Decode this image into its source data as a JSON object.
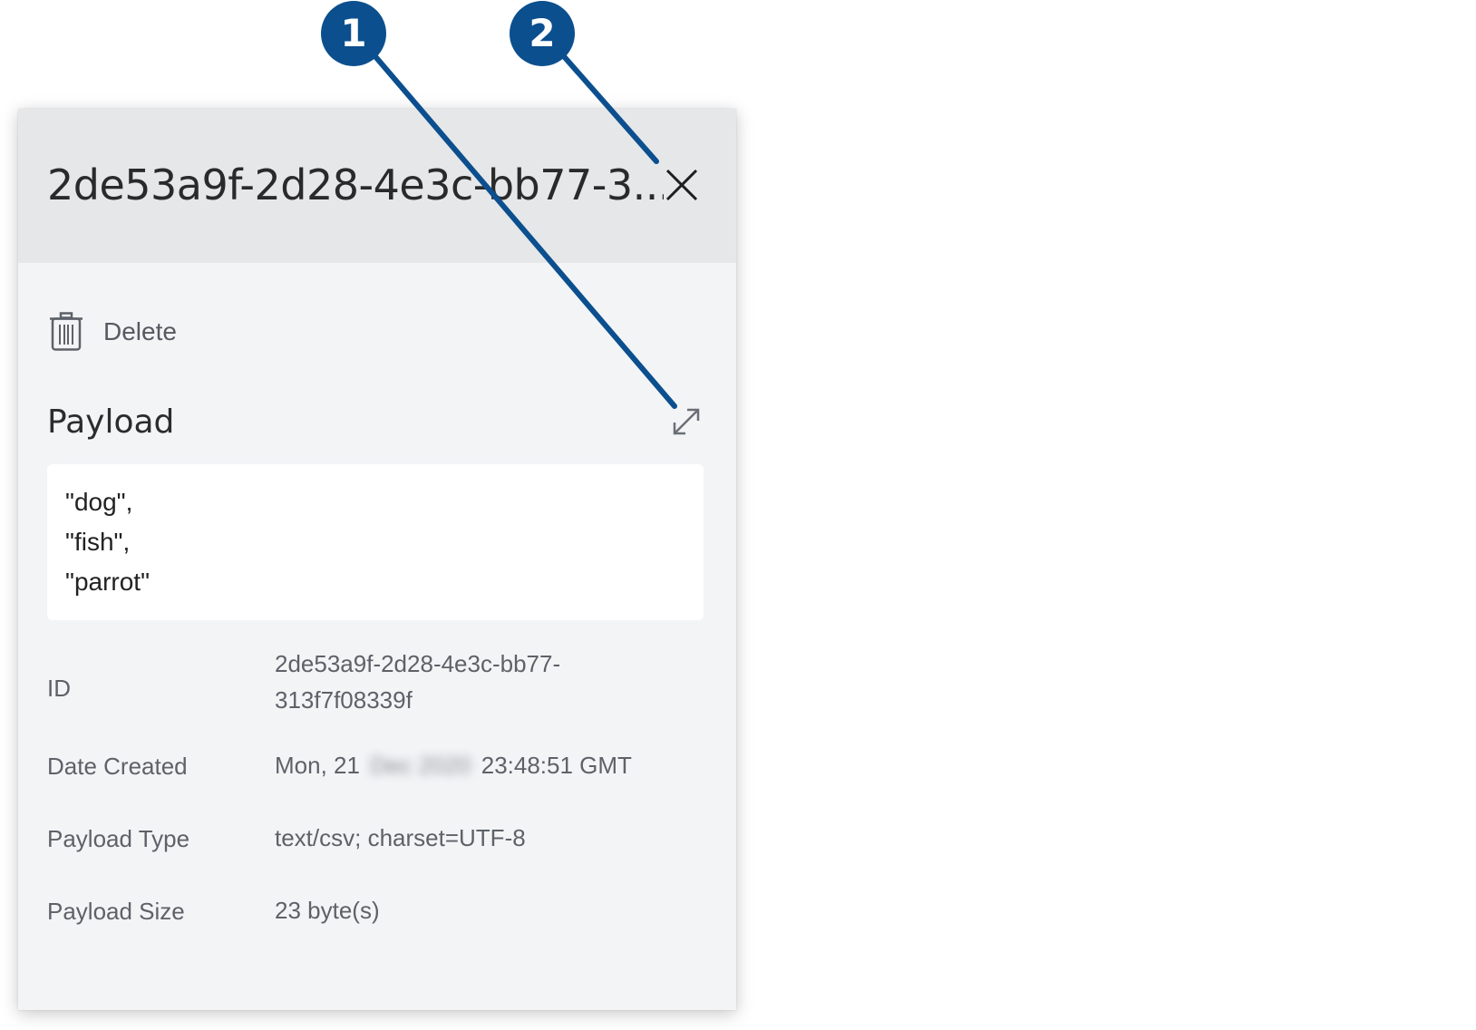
{
  "panel": {
    "title": "2de53a9f-2d28-4e3c-bb77-3...",
    "actions": {
      "delete_label": "Delete"
    },
    "payload": {
      "heading": "Payload",
      "lines": [
        "\"dog\",",
        "\"fish\",",
        "\"parrot\""
      ]
    },
    "details": {
      "id": {
        "label": "ID",
        "value_line1": "2de53a9f-2d28-4e3c-bb77-",
        "value_line2": "313f7f08339f"
      },
      "date_created": {
        "label": "Date Created",
        "value_prefix": "Mon, 21",
        "value_redacted": "Dec 2020",
        "value_suffix": "23:48:51 GMT"
      },
      "payload_type": {
        "label": "Payload Type",
        "value": "text/csv; charset=UTF-8"
      },
      "payload_size": {
        "label": "Payload Size",
        "value": "23 byte(s)"
      }
    }
  },
  "callouts": [
    {
      "number": "1"
    },
    {
      "number": "2"
    }
  ],
  "colors": {
    "callout": "#0b4f8e",
    "header_bg": "#e6e7e9",
    "panel_bg": "#f3f4f6"
  },
  "icons": {
    "close": "close-icon",
    "delete": "trash-icon",
    "expand": "expand-icon"
  }
}
